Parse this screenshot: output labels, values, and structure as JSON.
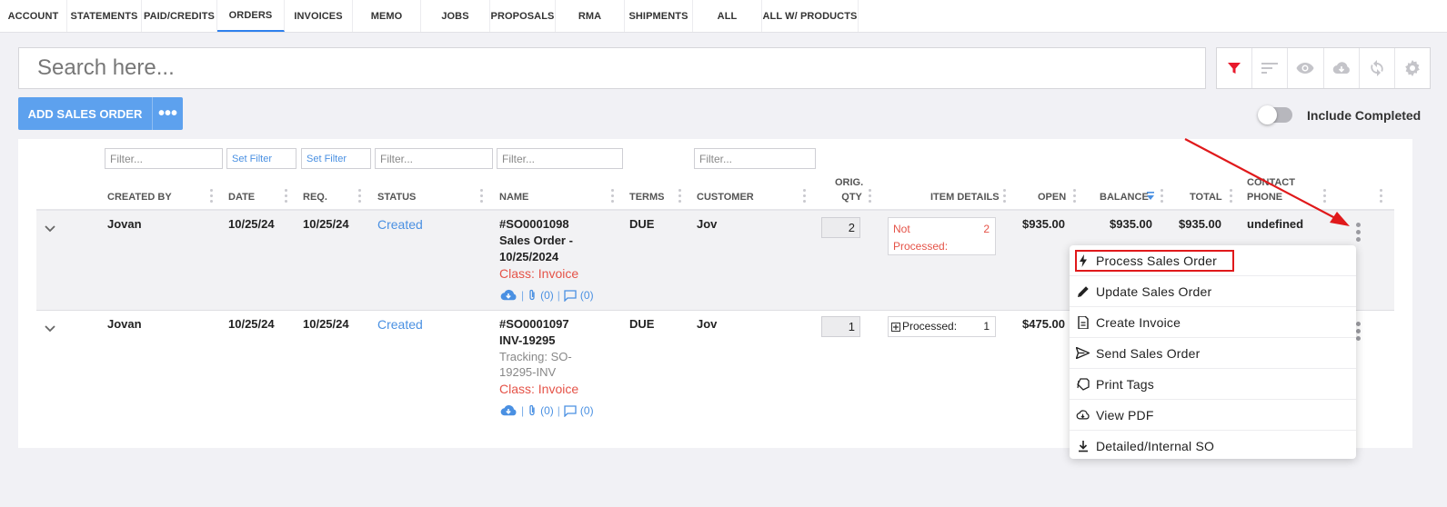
{
  "tabs": [
    {
      "label": "ACCOUNT"
    },
    {
      "label": "STATEMENTS"
    },
    {
      "label": "PAID/CREDITS"
    },
    {
      "label": "ORDERS"
    },
    {
      "label": "INVOICES"
    },
    {
      "label": "MEMO"
    },
    {
      "label": "JOBS"
    },
    {
      "label": "PROPOSALS"
    },
    {
      "label": "RMA"
    },
    {
      "label": "SHIPMENTS"
    },
    {
      "label": "ALL"
    },
    {
      "label": "ALL W/ PRODUCTS"
    }
  ],
  "search": {
    "placeholder": "Search here..."
  },
  "toolbar": {
    "add_label": "ADD SALES ORDER",
    "more_label": "•••",
    "include_completed_label": "Include Completed",
    "filter_active_color": "#e8192c"
  },
  "filters": {
    "created_by": "Filter...",
    "date": "Set Filter",
    "req": "Set Filter",
    "status": "Filter...",
    "name": "Filter...",
    "customer": "Filter..."
  },
  "columns": {
    "created_by": "CREATED BY",
    "date": "DATE",
    "req": "REQ.",
    "status": "STATUS",
    "name": "NAME",
    "terms": "TERMS",
    "customer": "CUSTOMER",
    "orig_qty_1": "ORIG.",
    "orig_qty_2": "QTY",
    "item_details": "ITEM DETAILS",
    "open": "OPEN",
    "balance": "BALANCE",
    "total": "TOTAL",
    "contact_phone_1": "CONTACT",
    "contact_phone_2": "PHONE"
  },
  "rows": [
    {
      "created_by": "Jovan",
      "date": "10/25/24",
      "req": "10/25/24",
      "status": "Created",
      "name_line1": "#SO0001098",
      "name_line2": "Sales Order -",
      "name_line3": "10/25/2024",
      "class": "Class: Invoice",
      "attach_count": "(0)",
      "comment_count": "(0)",
      "terms": "DUE",
      "customer": "Jov",
      "orig_qty": "2",
      "item_status_1": "Not",
      "item_status_2": "Processed:",
      "item_count": "2",
      "open": "$935.00",
      "balance": "$935.00",
      "total": "$935.00",
      "contact_phone": "undefined"
    },
    {
      "created_by": "Jovan",
      "date": "10/25/24",
      "req": "10/25/24",
      "status": "Created",
      "name_line1": "#SO0001097",
      "name_line2": "INV-19295",
      "tracking_line1": "Tracking: SO-",
      "tracking_line2": "19295-INV",
      "class": "Class: Invoice",
      "attach_count": "(0)",
      "comment_count": "(0)",
      "terms": "DUE",
      "customer": "Jov",
      "orig_qty": "1",
      "item_status": "Processed:",
      "item_count": "1",
      "open": "$475.00"
    }
  ],
  "menu": {
    "items": [
      {
        "label": "Process Sales Order",
        "icon": "lightning-icon"
      },
      {
        "label": "Update Sales Order",
        "icon": "pencil-icon"
      },
      {
        "label": "Create Invoice",
        "icon": "document-icon"
      },
      {
        "label": "Send Sales Order",
        "icon": "send-icon"
      },
      {
        "label": "Print Tags",
        "icon": "tags-icon"
      },
      {
        "label": "View PDF",
        "icon": "cloud-download-icon"
      },
      {
        "label": "Detailed/Internal SO",
        "icon": "download-icon"
      }
    ]
  },
  "colors": {
    "accent": "#5da1ee",
    "link": "#4a90e2",
    "danger": "#e55348",
    "annotation": "#e0191b"
  }
}
